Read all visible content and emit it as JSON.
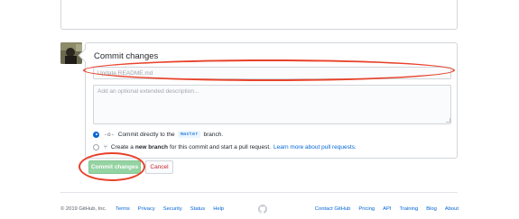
{
  "commit": {
    "title": "Commit changes",
    "summary_placeholder": "Update README.md",
    "description_placeholder": "Add an optional extended description...",
    "option_direct": {
      "icon": "git-commit-icon",
      "text_before": "Commit directly to the",
      "branch": "master",
      "text_after": "branch."
    },
    "option_new_branch": {
      "icon": "git-pull-request-icon",
      "text_before": "Create a",
      "bold": "new branch",
      "text_after": "for this commit and start a pull request.",
      "link": "Learn more about pull requests."
    },
    "commit_button": "Commit changes",
    "cancel_button": "Cancel"
  },
  "footer": {
    "copyright": "© 2019 GitHub, Inc.",
    "left_links": [
      "Terms",
      "Privacy",
      "Security",
      "Status",
      "Help"
    ],
    "right_links": [
      "Contact GitHub",
      "Pricing",
      "API",
      "Training",
      "Blog",
      "About"
    ],
    "logo_icon": "github-mark-icon"
  },
  "colors": {
    "annotation": "#e8422a",
    "commit_button": "#94d3a2",
    "link": "#0366d6",
    "cancel_text": "#cb2431"
  }
}
